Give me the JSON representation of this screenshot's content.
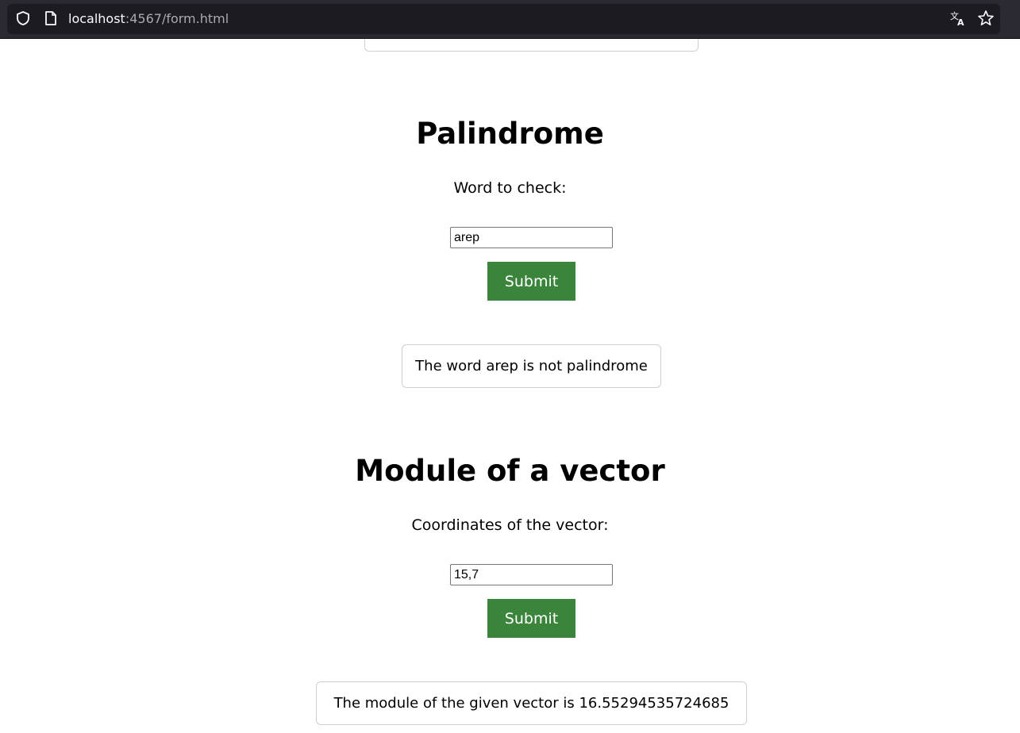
{
  "browser": {
    "url_host": "localhost",
    "url_path": ":4567/form.html",
    "icons": [
      "shield-icon",
      "page-icon",
      "translate-icon",
      "bookmark-star-icon"
    ]
  },
  "palindrome": {
    "title": "Palindrome",
    "label": "Word to check:",
    "input_value": "arep",
    "submit_label": "Submit",
    "result": "The word arep is not palindrome"
  },
  "vector": {
    "title": "Module of a vector",
    "label": "Coordinates of the vector:",
    "input_value": "15,7",
    "submit_label": "Submit",
    "result": "The module of the given vector is 16.55294535724685"
  },
  "colors": {
    "button_bg": "#3a843c",
    "toolbar_bg": "#2b2a33"
  }
}
